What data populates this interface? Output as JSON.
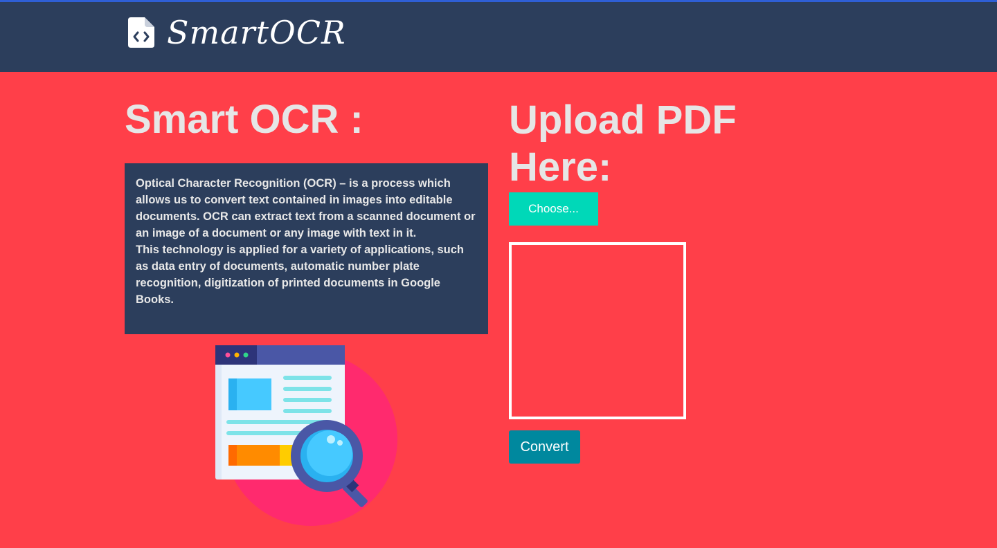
{
  "navbar": {
    "brand_icon": "file-code-icon",
    "brand_text": "SmartOCR"
  },
  "left": {
    "title": "Smart OCR :",
    "paragraph_1": "Optical Character Recognition (OCR) – is a process which allows us to convert text contained in images into editable documents. OCR can extract text from a scanned document or an image of a document or any image with text in it.",
    "paragraph_2": "This technology is applied for a variety of applications, such as data entry of documents, automatic number plate recognition, digitization of printed documents in Google Books.",
    "illustration_icon": "document-magnifier-icon"
  },
  "right": {
    "title": "Upload PDF Here:",
    "choose_label": "Choose...",
    "convert_label": "Convert"
  },
  "colors": {
    "background": "#ff3f49",
    "navbar": "#2c3e5c",
    "choose_button": "#00d8b8",
    "convert_button": "#00889e",
    "title_text": "#e6e6e6"
  }
}
